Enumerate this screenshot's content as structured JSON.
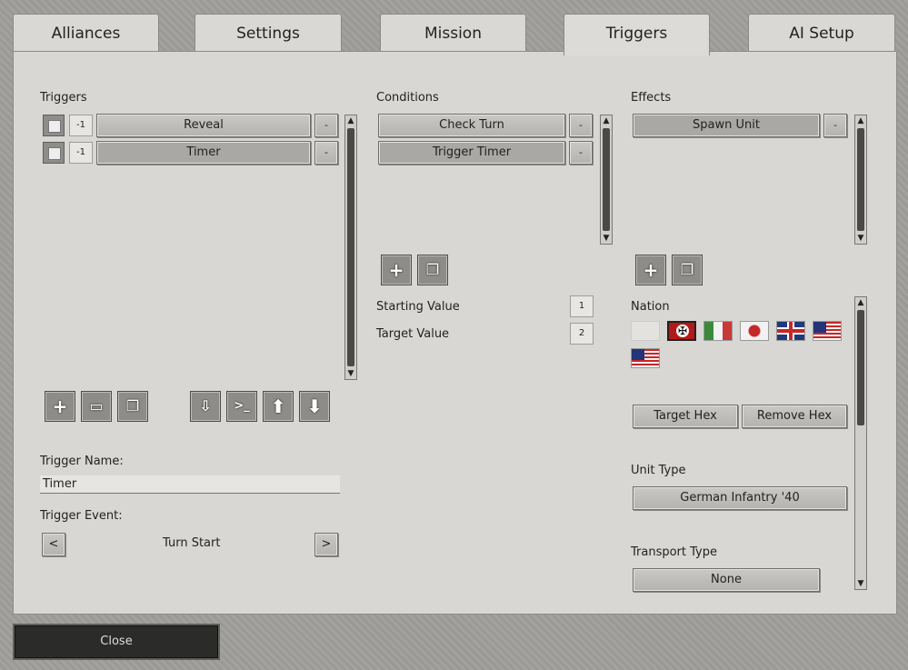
{
  "tabs": [
    {
      "label": "Alliances"
    },
    {
      "label": "Settings"
    },
    {
      "label": "Mission"
    },
    {
      "label": "Triggers"
    },
    {
      "label": "AI Setup"
    }
  ],
  "triggers": {
    "title": "Triggers",
    "items": [
      {
        "num": "-1",
        "label": "Reveal",
        "remove": "-"
      },
      {
        "num": "-1",
        "label": "Timer",
        "remove": "-"
      }
    ],
    "name_label": "Trigger Name:",
    "name_value": "Timer",
    "event_label": "Trigger Event:",
    "event_value": "Turn Start",
    "prev": "<",
    "next": ">"
  },
  "conditions": {
    "title": "Conditions",
    "items": [
      {
        "label": "Check Turn",
        "remove": "-"
      },
      {
        "label": "Trigger Timer",
        "remove": "-"
      }
    ],
    "starting_label": "Starting Value",
    "starting_value": "1",
    "target_label": "Target Value",
    "target_value": "2"
  },
  "effects": {
    "title": "Effects",
    "items": [
      {
        "label": "Spawn Unit",
        "remove": "-"
      }
    ],
    "nation_label": "Nation",
    "target_hex": "Target Hex",
    "remove_hex": "Remove Hex",
    "unit_type_label": "Unit Type",
    "unit_type_value": "German Infantry '40",
    "transport_label": "Transport Type",
    "transport_value": "None"
  },
  "footer": {
    "close": "Close"
  }
}
